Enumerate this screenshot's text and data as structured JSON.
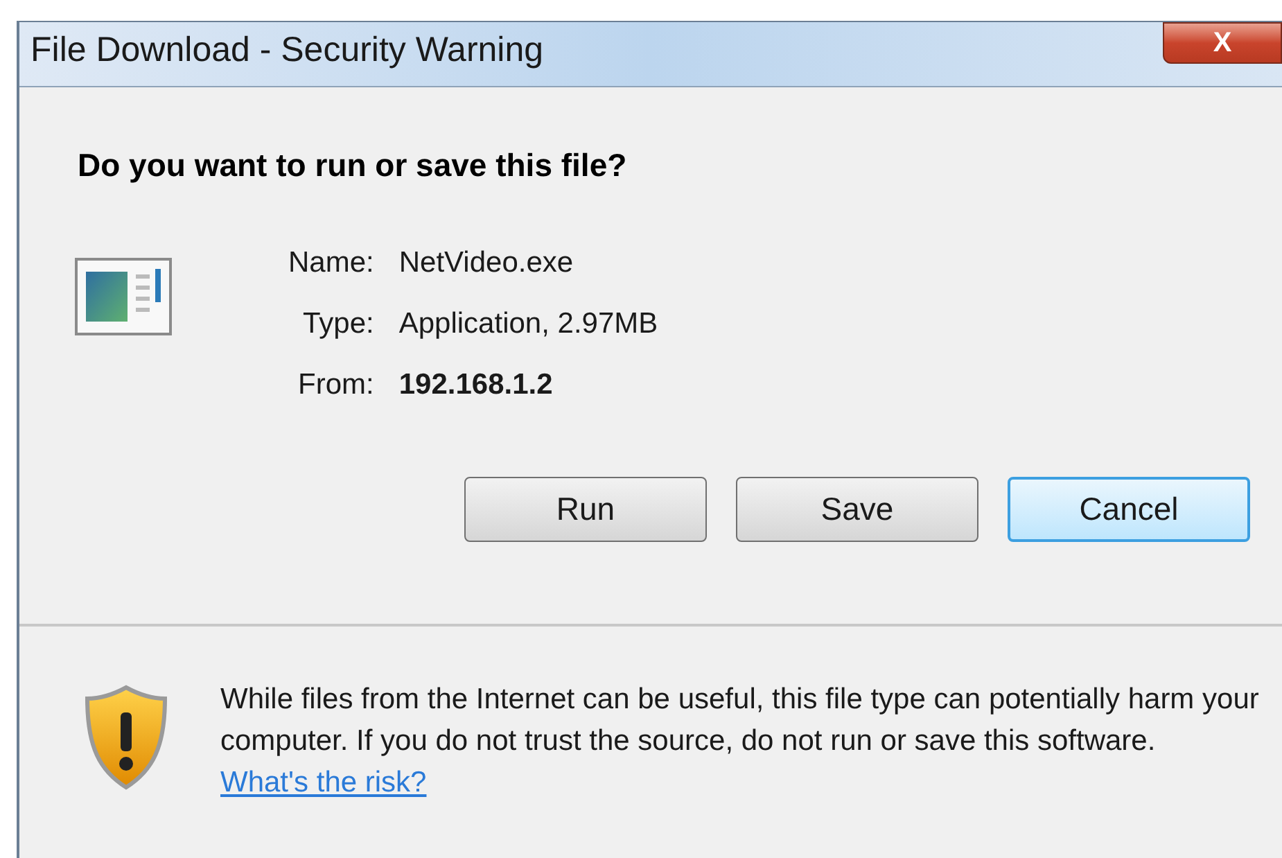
{
  "window": {
    "title": "File Download - Security Warning",
    "close_label": "X"
  },
  "question": "Do you want to run or save this file?",
  "details": [
    {
      "label": "Name:",
      "value": "NetVideo.exe",
      "bold": false
    },
    {
      "label": "Type:",
      "value": "Application, 2.97MB",
      "bold": false
    },
    {
      "label": "From:",
      "value": "192.168.1.2",
      "bold": true
    }
  ],
  "buttons": [
    {
      "label": "Run",
      "default": false
    },
    {
      "label": "Save",
      "default": false
    },
    {
      "label": "Cancel",
      "default": true
    }
  ],
  "warning": {
    "text": "While files from the Internet can be useful, this file type can potentially harm your computer. If you do not trust the source, do not run or save this software.",
    "link": "What's the risk?"
  }
}
